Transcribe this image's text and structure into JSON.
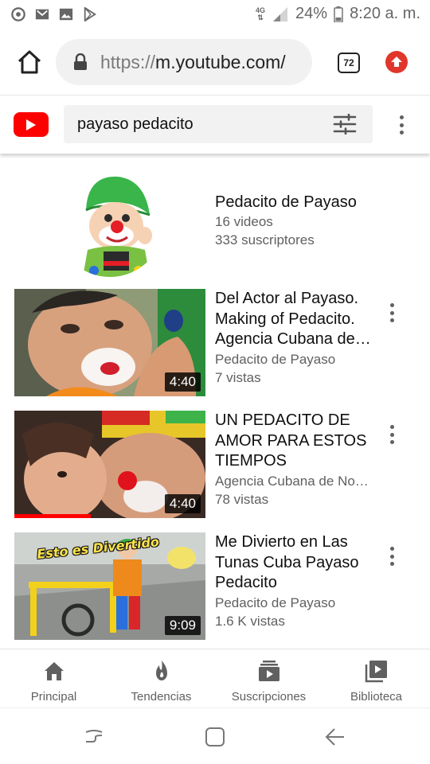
{
  "status_bar": {
    "left_icons": [
      "chrome-icon",
      "gmail-icon",
      "gallery-icon",
      "play-store-icon"
    ],
    "network": "4G",
    "battery": "24%",
    "time": "8:20 a. m."
  },
  "browser": {
    "url_scheme": "https://",
    "url_host": "m.youtube.com/",
    "tab_count": "72"
  },
  "youtube": {
    "search_query": "payaso pedacito"
  },
  "channel": {
    "name": "Pedacito de Payaso",
    "videos": "16 videos",
    "subscribers": "333 suscriptores"
  },
  "videos": [
    {
      "title": "Del Actor al Payaso. Making of Pedacito. Agencia Cubana de Noticias",
      "channel": "Pedacito de Payaso",
      "views": "7 vistas",
      "duration": "4:40",
      "watched_fraction": 0
    },
    {
      "title": "UN PEDACITO DE AMOR PARA ESTOS TIEMPOS",
      "channel": "Agencia Cubana de Noticias",
      "views": "78 vistas",
      "duration": "4:40",
      "watched_fraction": 0.4
    },
    {
      "title": "Me Divierto en Las Tunas Cuba Payaso Pedacito",
      "channel": "Pedacito de Payaso",
      "views": "1.6 K vistas",
      "duration": "9:09",
      "watched_fraction": 0,
      "thumb_overlay": "Esto es Divertido"
    }
  ],
  "bottom_nav": [
    {
      "label": "Principal",
      "icon": "home-icon"
    },
    {
      "label": "Tendencias",
      "icon": "flame-icon"
    },
    {
      "label": "Suscripciones",
      "icon": "subscriptions-icon"
    },
    {
      "label": "Biblioteca",
      "icon": "library-icon"
    }
  ],
  "colors": {
    "youtube_red": "#ff0000",
    "update_badge": "#e0362b",
    "secondary_text": "#606060"
  }
}
